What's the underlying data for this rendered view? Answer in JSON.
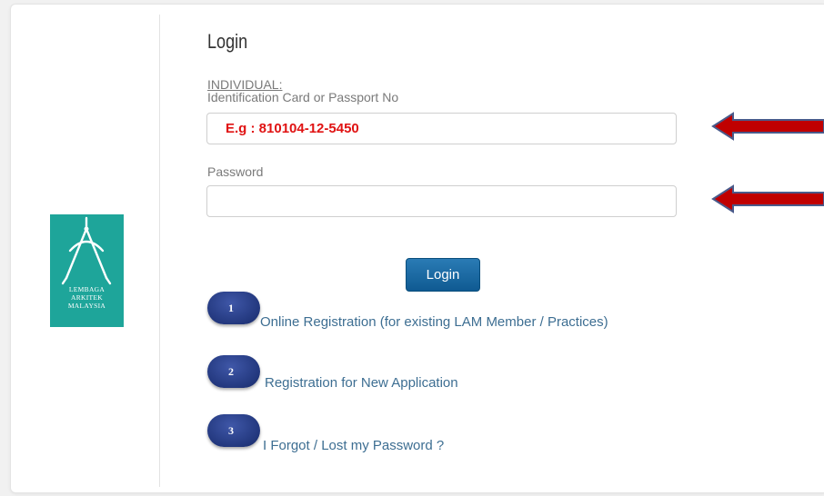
{
  "logo": {
    "lines": [
      "LEMBAGA",
      "ARKITEK",
      "MALAYSIA"
    ],
    "color": "#1ea59a"
  },
  "form": {
    "title": "Login",
    "individual_label": "INDIVIDUAL:",
    "id_label": "Identification Card or Passport No",
    "id_placeholder": "E.g : 810104-12-5450",
    "id_value": "",
    "password_label": "Password",
    "password_value": "",
    "login_button": "Login"
  },
  "options": [
    {
      "number": "1",
      "label": "Online Registration (for existing LAM Member / Practices)"
    },
    {
      "number": "2",
      "label": "Registration for New Application"
    },
    {
      "number": "3",
      "label": "I Forgot / Lost my Password ?"
    }
  ],
  "colors": {
    "accent_link": "#3d6e92",
    "button": "#1a669f",
    "arrow": "#c00000",
    "placeholder_red": "#e01212",
    "pill": "#23387e"
  }
}
